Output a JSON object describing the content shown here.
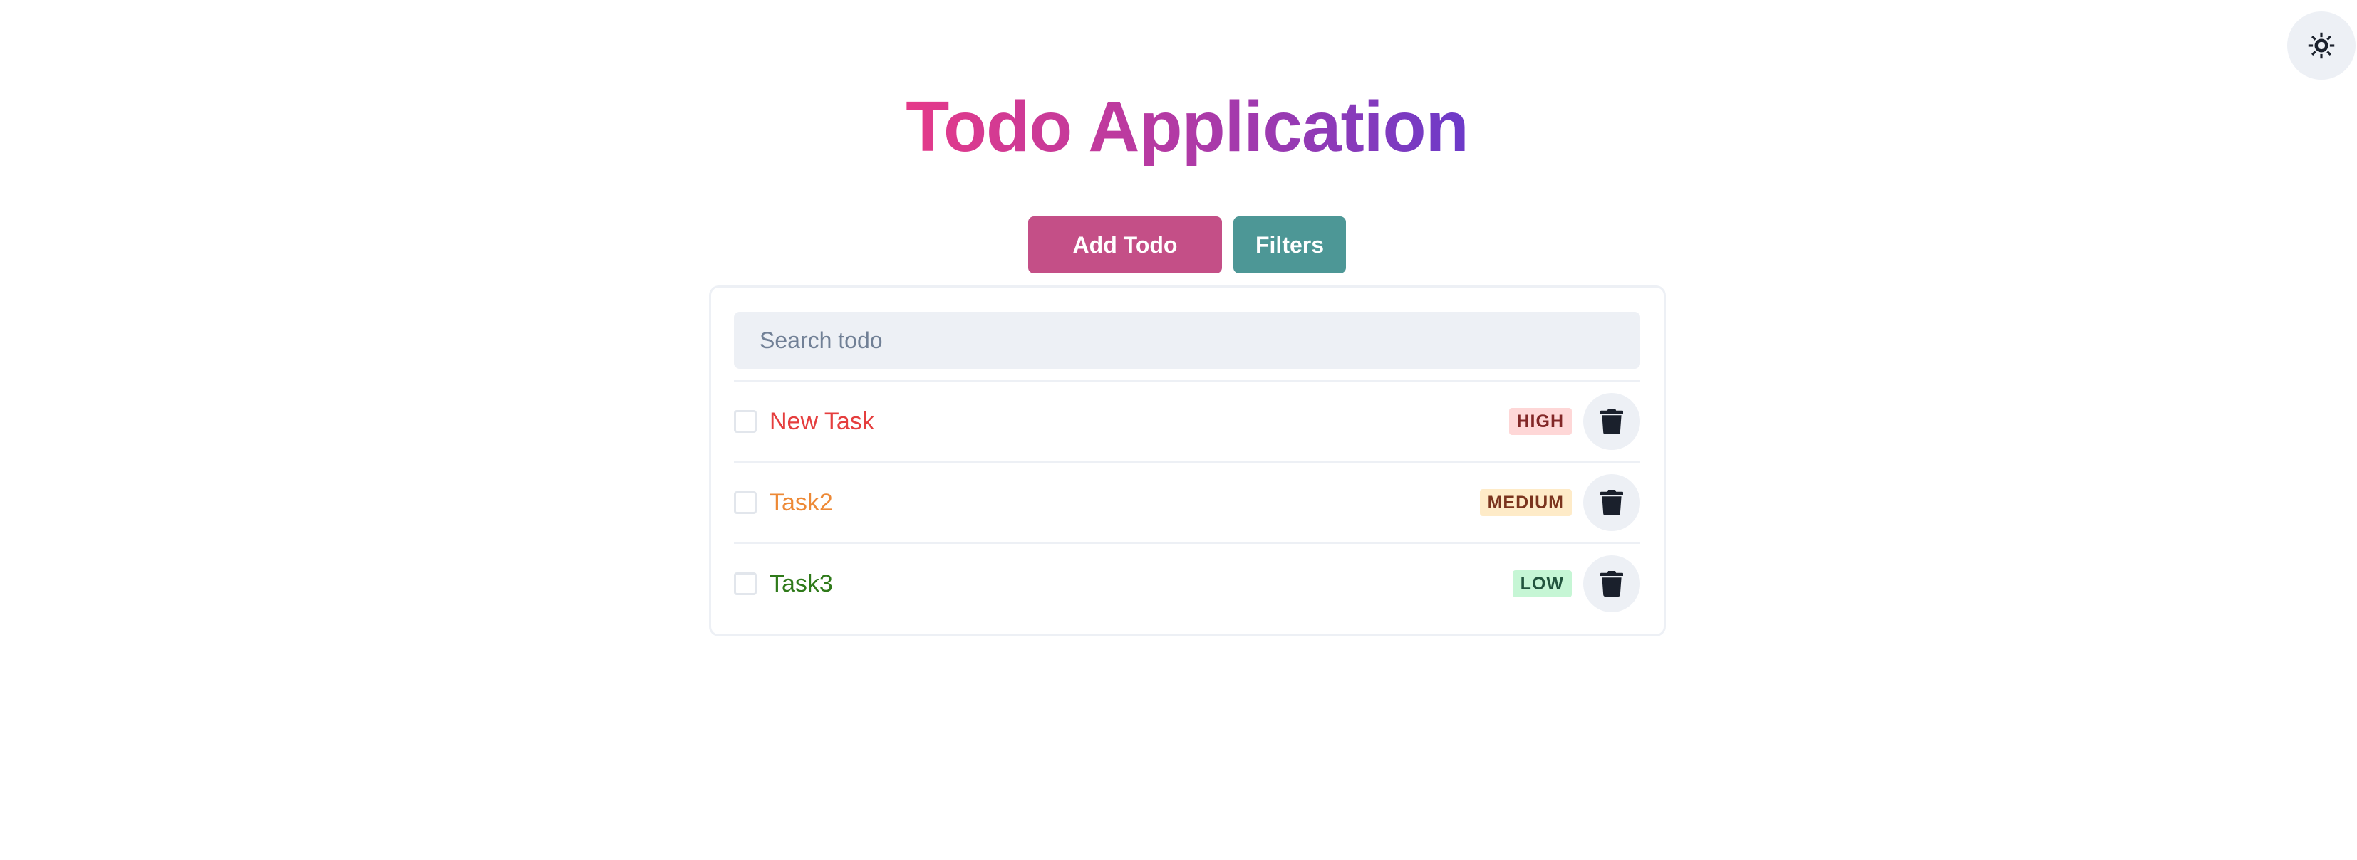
{
  "app": {
    "title": "Todo Application",
    "theme_toggle_icon": "sun-icon"
  },
  "actions": {
    "add_label": "Add Todo",
    "filters_label": "Filters",
    "add_color": "#c44f87",
    "filters_color": "#4d9796"
  },
  "search": {
    "placeholder": "Search todo",
    "value": ""
  },
  "todos": [
    {
      "text": "New Task",
      "priority": "HIGH",
      "text_color": "#e53e3e",
      "badge_bg": "#fed7d7",
      "badge_color": "#822727",
      "completed": false,
      "delete_icon": "trash-icon"
    },
    {
      "text": "Task2",
      "priority": "MEDIUM",
      "text_color": "#ed8936",
      "badge_bg": "#feebc8",
      "badge_color": "#7b341e",
      "completed": false,
      "delete_icon": "trash-icon"
    },
    {
      "text": "Task3",
      "priority": "LOW",
      "text_color": "#2f7a1a",
      "badge_bg": "#c6f6d5",
      "badge_color": "#22543d",
      "completed": false,
      "delete_icon": "trash-icon"
    }
  ]
}
